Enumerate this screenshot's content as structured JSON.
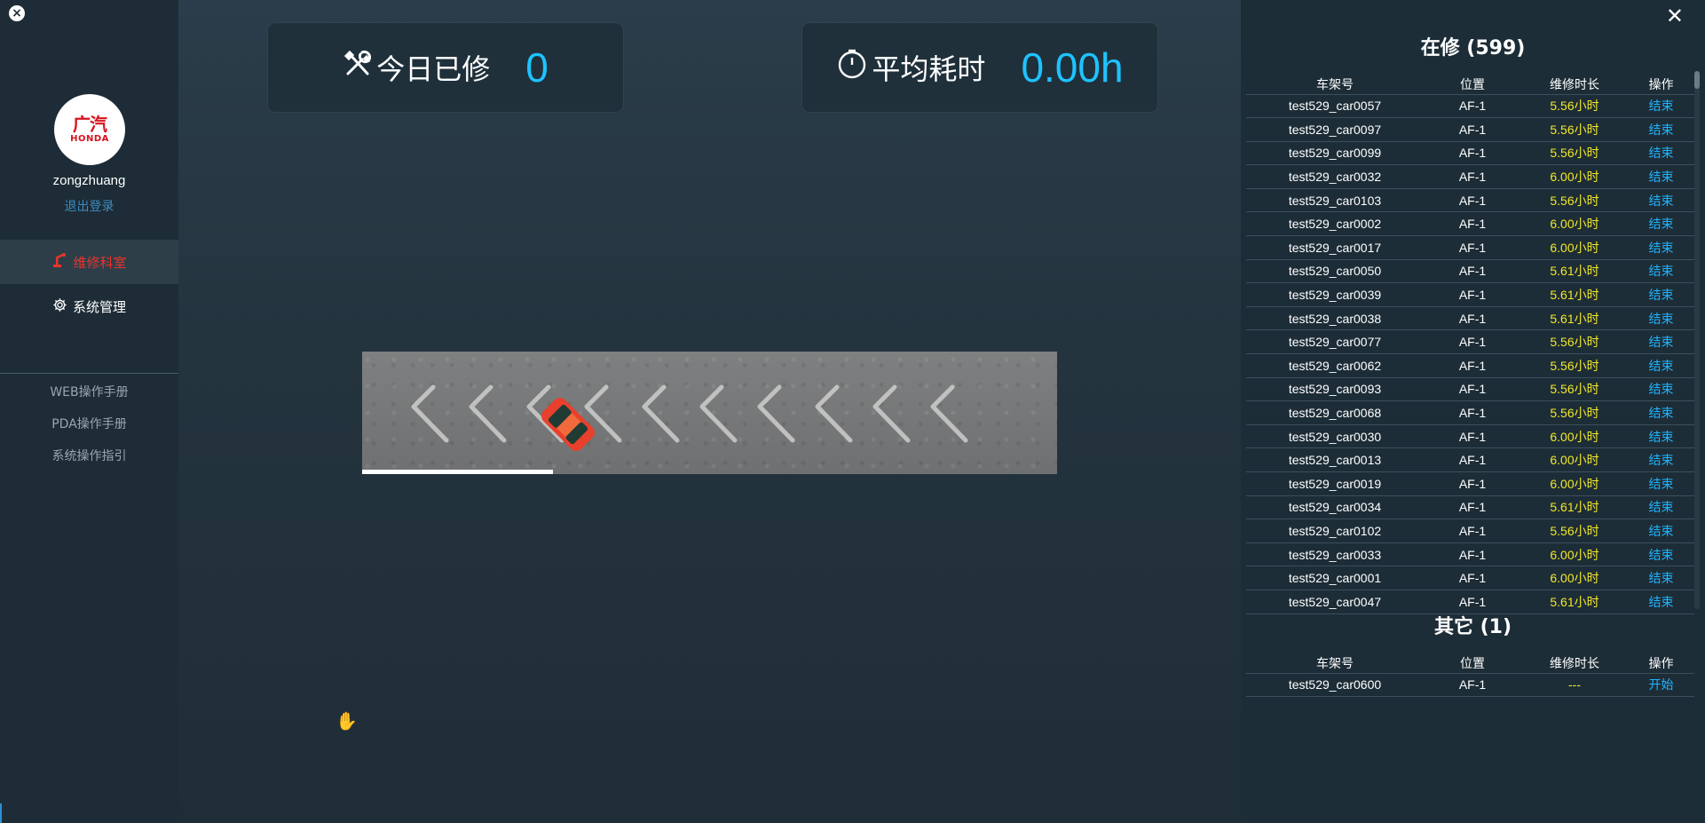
{
  "sidebar": {
    "close_symbol": "×",
    "logo_text_top": "广汽",
    "logo_text_bottom": "HONDA",
    "username": "zongzhuang",
    "logout": "退出登录",
    "nav": [
      {
        "label": "维修科室",
        "icon": "robot-arm-icon"
      },
      {
        "label": "系统管理",
        "icon": "gear-icon"
      }
    ],
    "links": [
      "WEB操作手册",
      "PDA操作手册",
      "系统操作指引"
    ]
  },
  "stats": {
    "repaired_today_label": "今日已修",
    "repaired_today_value": "0",
    "avg_time_label": "平均耗时",
    "avg_time_value": "0.00h"
  },
  "loader": {
    "progress": 0.275
  },
  "in_repair": {
    "title": "在修 (599)",
    "headers": [
      "车架号",
      "位置",
      "维修时长",
      "操作"
    ],
    "rows": [
      [
        "test529_car0057",
        "AF-1",
        "5.56小时",
        "结束"
      ],
      [
        "test529_car0097",
        "AF-1",
        "5.56小时",
        "结束"
      ],
      [
        "test529_car0099",
        "AF-1",
        "5.56小时",
        "结束"
      ],
      [
        "test529_car0032",
        "AF-1",
        "6.00小时",
        "结束"
      ],
      [
        "test529_car0103",
        "AF-1",
        "5.56小时",
        "结束"
      ],
      [
        "test529_car0002",
        "AF-1",
        "6.00小时",
        "结束"
      ],
      [
        "test529_car0017",
        "AF-1",
        "6.00小时",
        "结束"
      ],
      [
        "test529_car0050",
        "AF-1",
        "5.61小时",
        "结束"
      ],
      [
        "test529_car0039",
        "AF-1",
        "5.61小时",
        "结束"
      ],
      [
        "test529_car0038",
        "AF-1",
        "5.61小时",
        "结束"
      ],
      [
        "test529_car0077",
        "AF-1",
        "5.56小时",
        "结束"
      ],
      [
        "test529_car0062",
        "AF-1",
        "5.56小时",
        "结束"
      ],
      [
        "test529_car0093",
        "AF-1",
        "5.56小时",
        "结束"
      ],
      [
        "test529_car0068",
        "AF-1",
        "5.56小时",
        "结束"
      ],
      [
        "test529_car0030",
        "AF-1",
        "6.00小时",
        "结束"
      ],
      [
        "test529_car0013",
        "AF-1",
        "6.00小时",
        "结束"
      ],
      [
        "test529_car0019",
        "AF-1",
        "6.00小时",
        "结束"
      ],
      [
        "test529_car0034",
        "AF-1",
        "5.61小时",
        "结束"
      ],
      [
        "test529_car0102",
        "AF-1",
        "5.56小时",
        "结束"
      ],
      [
        "test529_car0033",
        "AF-1",
        "6.00小时",
        "结束"
      ],
      [
        "test529_car0001",
        "AF-1",
        "6.00小时",
        "结束"
      ],
      [
        "test529_car0047",
        "AF-1",
        "5.61小时",
        "结束"
      ]
    ]
  },
  "other": {
    "title": "其它 (1)",
    "headers": [
      "车架号",
      "位置",
      "维修时长",
      "操作"
    ],
    "rows": [
      [
        "test529_car0600",
        "AF-1",
        "---",
        "开始"
      ]
    ]
  },
  "colors": {
    "accent_blue": "#1ec3ff",
    "duration_yellow": "#f2e72a",
    "active_red": "#e8342c",
    "link_blue": "#1eb4ff"
  }
}
